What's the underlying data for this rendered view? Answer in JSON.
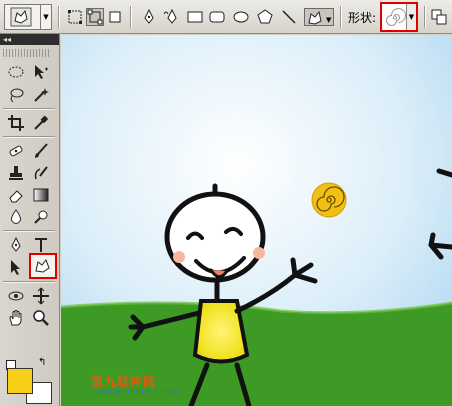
{
  "options_bar": {
    "shape_label": "形状:",
    "icons": [
      "preset-custom-shape-icon",
      "shape-layers-icon",
      "paths-icon",
      "fill-pixels-icon",
      "pen-icon",
      "freeform-pen-icon",
      "rectangle-icon",
      "rounded-rectangle-icon",
      "ellipse-icon",
      "polygon-icon",
      "line-icon",
      "custom-shape-icon",
      "spiral-shape-icon",
      "combine-mode-icon"
    ]
  },
  "toolbox": {
    "header": "◂◂",
    "foreground_color": "#f7cf18",
    "background_color": "#ffffff"
  },
  "canvas": {
    "sky_color": "#cfe6f5",
    "grass_color": "#3d9a24",
    "shirt_color": "#f2e424",
    "sun_color": "#f2c014",
    "watermark": "第九软件网",
    "watermark_sub": "WWW.D9SOFT.COM"
  },
  "highlight_color": "#e00000"
}
